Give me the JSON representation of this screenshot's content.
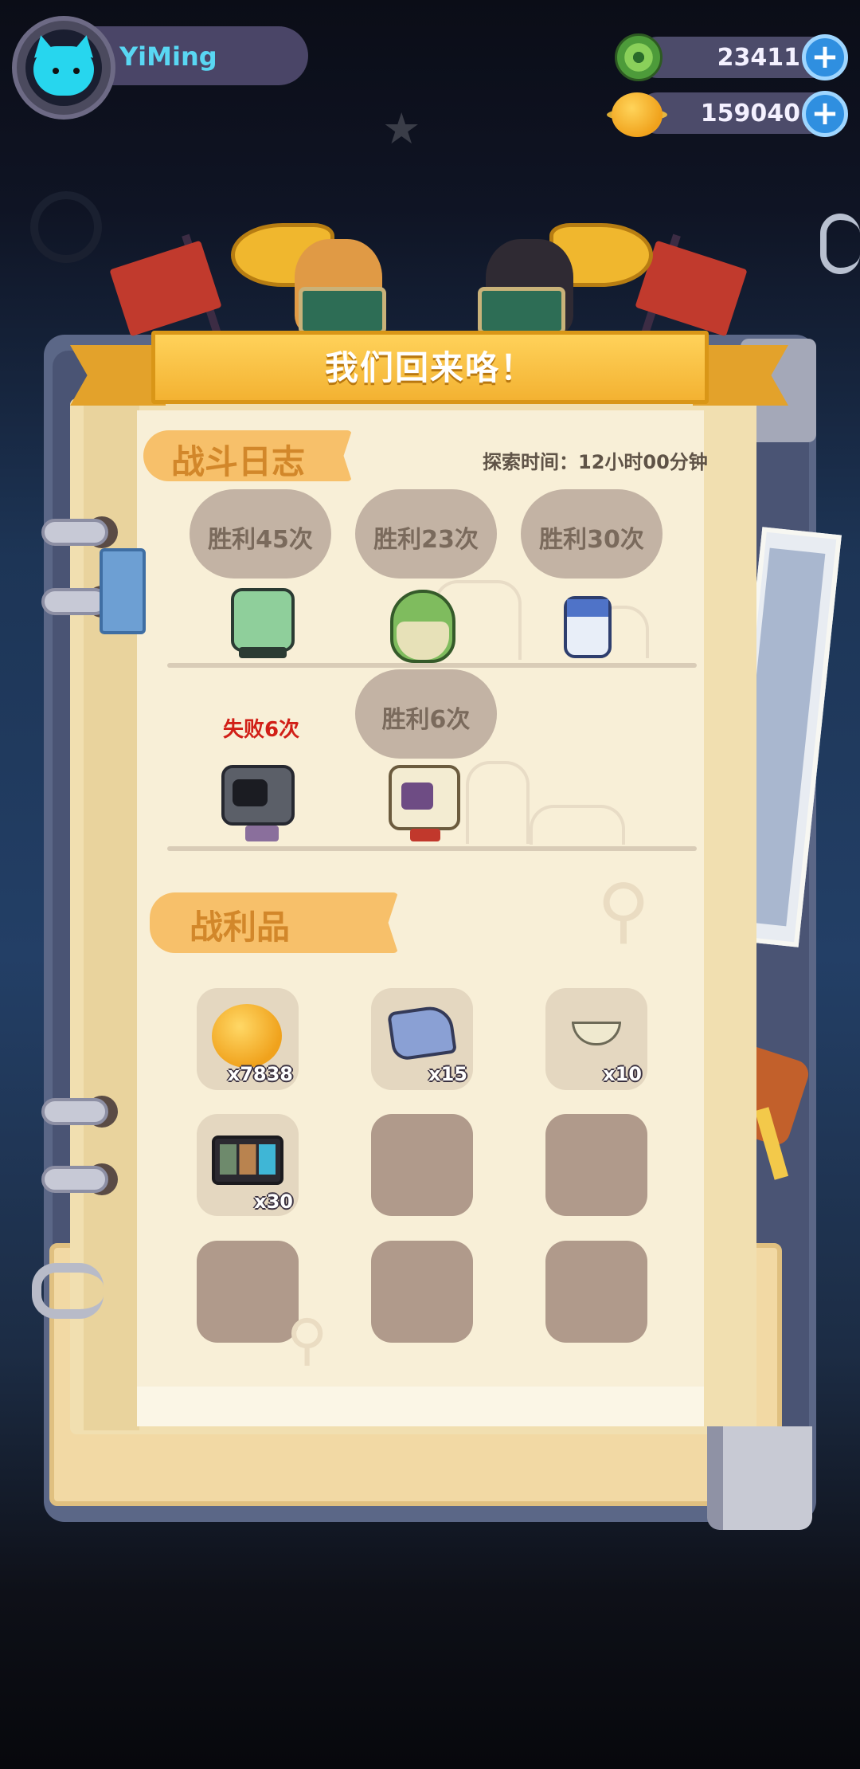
{
  "player": {
    "name": "YiMing"
  },
  "currencies": [
    {
      "name": "gem",
      "value": "23411"
    },
    {
      "name": "coin",
      "value": "159040"
    }
  ],
  "banner": {
    "title": "我们回来咯！"
  },
  "battle_log": {
    "title": "战斗日志",
    "explore_time": "探索时间：12小时00分钟",
    "results": [
      {
        "text": "胜利45次",
        "outcome": "win"
      },
      {
        "text": "胜利23次",
        "outcome": "win"
      },
      {
        "text": "胜利30次",
        "outcome": "win"
      },
      {
        "text": "失败6次",
        "outcome": "lose"
      },
      {
        "text": "胜利6次",
        "outcome": "win"
      }
    ]
  },
  "loot": {
    "title": "战利品",
    "items": [
      {
        "icon": "coin-icon",
        "qty": "x7838"
      },
      {
        "icon": "ore-icon",
        "qty": "x15"
      },
      {
        "icon": "eggshell-icon",
        "qty": "x10"
      },
      {
        "icon": "photo-card-icon",
        "qty": "x30"
      }
    ]
  },
  "colors": {
    "accent": "#f7c06a",
    "win_bubble": "#c3b3a4",
    "lose": "#d11f17"
  }
}
